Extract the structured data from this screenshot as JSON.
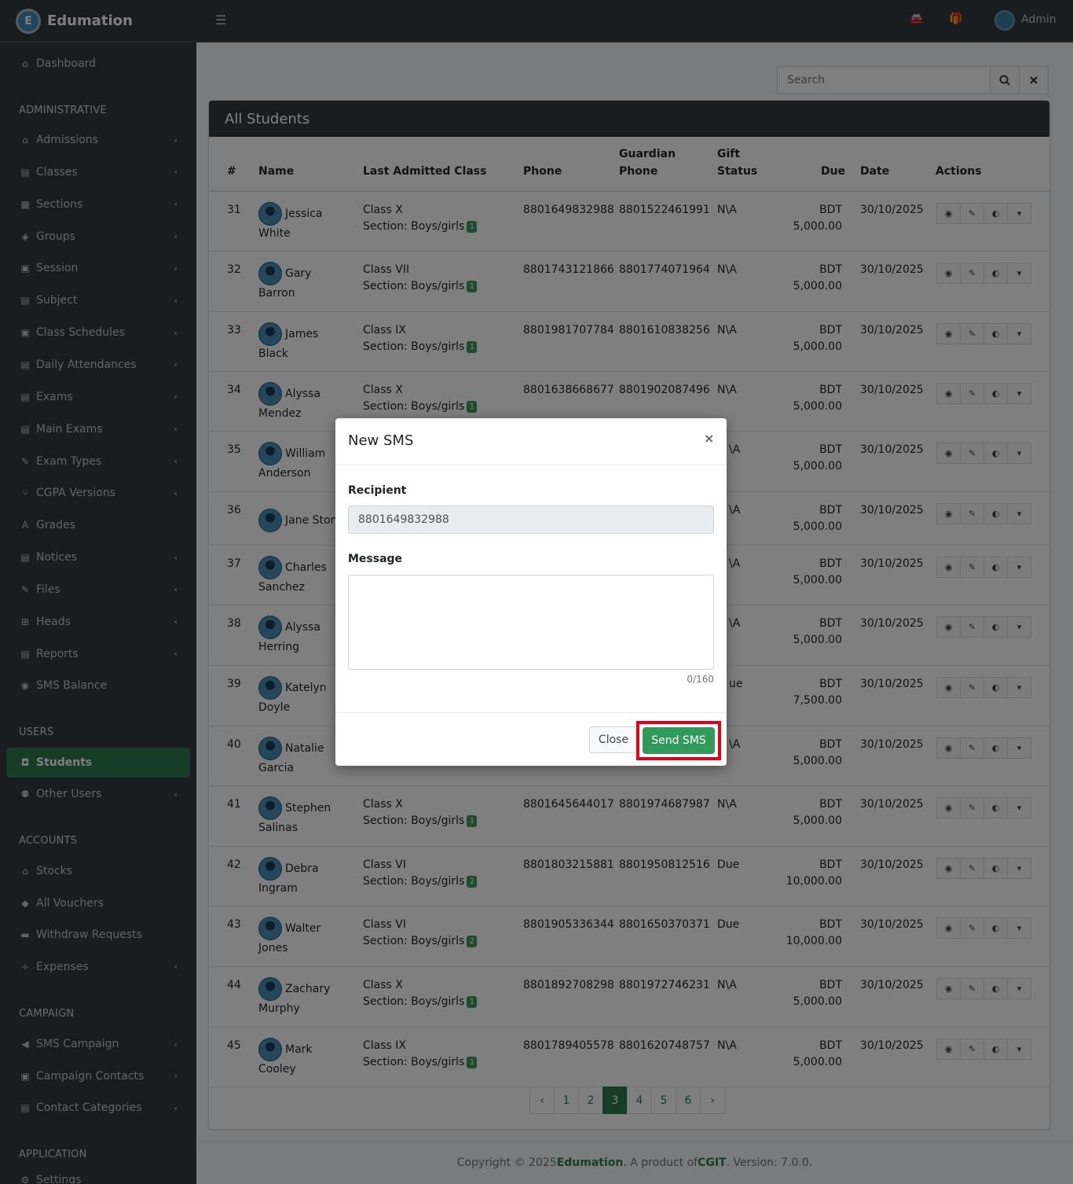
{
  "brand": {
    "name": "Edumation",
    "logo_letter": "E"
  },
  "topbar": {
    "user": "Admin",
    "menu_icon": "☰",
    "car_icon": "🚘",
    "gift_icon": "🎁"
  },
  "sidebar": {
    "dashboard": "Dashboard",
    "header_admin": "ADMINISTRATIVE",
    "admin_items": [
      "Admissions",
      "Classes",
      "Sections",
      "Groups",
      "Session",
      "Subject",
      "Class Schedules",
      "Daily Attendances",
      "Exams",
      "Main Exams",
      "Exam Types",
      "CGPA Versions",
      "Grades",
      "Notices",
      "Files",
      "Heads",
      "Reports",
      "SMS Balance"
    ],
    "header_users": "USERS",
    "users_items": [
      "Students",
      "Other Users"
    ],
    "header_accounts": "ACCOUNTS",
    "accounts_items": [
      "Stocks",
      "All Vouchers",
      "Withdraw Requests",
      "Expenses"
    ],
    "header_campaign": "CAMPAIGN",
    "campaign_items": [
      "SMS Campaign",
      "Campaign Contacts",
      "Contact Categories"
    ],
    "header_application": "APPLICATION",
    "application_items": [
      "Settings"
    ]
  },
  "search": {
    "placeholder": "Search"
  },
  "card": {
    "title": "All Students"
  },
  "table": {
    "headers": {
      "num": "#",
      "name": "Name",
      "last_class": "Last Admitted Class",
      "phone": "Phone",
      "guardian_1": "Guardian",
      "guardian_2": "Phone",
      "gift_1": "Gift",
      "gift_2": "Status",
      "due": "Due",
      "date": "Date",
      "actions": "Actions"
    },
    "rows": [
      {
        "num": "31",
        "first": "Jessica",
        "last": "White",
        "class": "Class X",
        "section": "Section: Boys/girls",
        "badge": "1",
        "phone": "8801649832988",
        "gphone": "8801522461991",
        "gift": "N\\A",
        "cur": "BDT",
        "due": "5,000.00",
        "date": "30/10/2025"
      },
      {
        "num": "32",
        "first": "Gary",
        "last": "Barron",
        "class": "Class VII",
        "section": "Section: Boys/girls",
        "badge": "1",
        "phone": "8801743121866",
        "gphone": "8801774071964",
        "gift": "N\\A",
        "cur": "BDT",
        "due": "5,000.00",
        "date": "30/10/2025"
      },
      {
        "num": "33",
        "first": "James",
        "last": "Black",
        "class": "Class IX",
        "section": "Section: Boys/girls",
        "badge": "1",
        "phone": "8801981707784",
        "gphone": "8801610838256",
        "gift": "N\\A",
        "cur": "BDT",
        "due": "5,000.00",
        "date": "30/10/2025"
      },
      {
        "num": "34",
        "first": "Alyssa",
        "last": "Mendez",
        "class": "Class X",
        "section": "Section: Boys/girls",
        "badge": "1",
        "phone": "8801638668677",
        "gphone": "8801902087496",
        "gift": "N\\A",
        "cur": "BDT",
        "due": "5,000.00",
        "date": "30/10/2025"
      },
      {
        "num": "35",
        "first": "William",
        "last": "Anderson",
        "class": "",
        "section": "",
        "badge": "",
        "phone": "",
        "gphone": "",
        "gift": "\\A",
        "cur": "BDT",
        "due": "5,000.00",
        "date": "30/10/2025"
      },
      {
        "num": "36",
        "first": "Jane Stone",
        "last": "",
        "class": "",
        "section": "",
        "badge": "",
        "phone": "",
        "gphone": "",
        "gift": "\\A",
        "cur": "BDT",
        "due": "5,000.00",
        "date": "30/10/2025"
      },
      {
        "num": "37",
        "first": "Charles",
        "last": "Sanchez",
        "class": "",
        "section": "",
        "badge": "",
        "phone": "",
        "gphone": "",
        "gift": "\\A",
        "cur": "BDT",
        "due": "5,000.00",
        "date": "30/10/2025"
      },
      {
        "num": "38",
        "first": "Alyssa",
        "last": "Herring",
        "class": "",
        "section": "",
        "badge": "",
        "phone": "",
        "gphone": "",
        "gift": "\\A",
        "cur": "BDT",
        "due": "5,000.00",
        "date": "30/10/2025"
      },
      {
        "num": "39",
        "first": "Katelyn",
        "last": "Doyle",
        "class": "",
        "section": "",
        "badge": "",
        "phone": "",
        "gphone": "",
        "gift": "ue",
        "cur": "BDT",
        "due": "7,500.00",
        "date": "30/10/2025"
      },
      {
        "num": "40",
        "first": "Natalie",
        "last": "Garcia",
        "class": "",
        "section": "",
        "badge": "",
        "phone": "",
        "gphone": "",
        "gift": "\\A",
        "cur": "BDT",
        "due": "5,000.00",
        "date": "30/10/2025"
      },
      {
        "num": "41",
        "first": "Stephen",
        "last": "Salinas",
        "class": "Class X",
        "section": "Section: Boys/girls",
        "badge": "1",
        "phone": "8801645644017",
        "gphone": "8801974687987",
        "gift": "N\\A",
        "cur": "BDT",
        "due": "5,000.00",
        "date": "30/10/2025"
      },
      {
        "num": "42",
        "first": "Debra",
        "last": "Ingram",
        "class": "Class VI",
        "section": "Section: Boys/girls",
        "badge": "2",
        "phone": "8801803215881",
        "gphone": "8801950812516",
        "gift": "Due",
        "cur": "BDT",
        "due": "10,000.00",
        "date": "30/10/2025"
      },
      {
        "num": "43",
        "first": "Walter",
        "last": "Jones",
        "class": "Class VI",
        "section": "Section: Boys/girls",
        "badge": "2",
        "phone": "8801905336344",
        "gphone": "8801650370371",
        "gift": "Due",
        "cur": "BDT",
        "due": "10,000.00",
        "date": "30/10/2025"
      },
      {
        "num": "44",
        "first": "Zachary",
        "last": "Murphy",
        "class": "Class X",
        "section": "Section: Boys/girls",
        "badge": "1",
        "phone": "8801892708298",
        "gphone": "8801972746231",
        "gift": "N\\A",
        "cur": "BDT",
        "due": "5,000.00",
        "date": "30/10/2025"
      },
      {
        "num": "45",
        "first": "Mark",
        "last": "Cooley",
        "class": "Class IX",
        "section": "Section: Boys/girls",
        "badge": "1",
        "phone": "8801789405578",
        "gphone": "8801620748757",
        "gift": "N\\A",
        "cur": "BDT",
        "due": "5,000.00",
        "date": "30/10/2025"
      }
    ]
  },
  "pagination": {
    "prev": "‹",
    "next": "›",
    "pages": [
      "1",
      "2",
      "3",
      "4",
      "5",
      "6"
    ],
    "current": "3"
  },
  "footer": {
    "prefix": "Copyright © 2025 ",
    "brand": "Edumation",
    "middle": ". A product of ",
    "company": "CGIT",
    "suffix": ". Version: 7.0.0."
  },
  "modal": {
    "title": "New SMS",
    "close_x": "×",
    "recipient_label": "Recipient",
    "recipient_value": "8801649832988",
    "message_label": "Message",
    "counter": "0/160",
    "close_button": "Close",
    "send_button": "Send SMS"
  },
  "colors": {
    "accent": "#2f7a4e",
    "sidebar": "#343a40",
    "highlight": "#e3001b"
  }
}
